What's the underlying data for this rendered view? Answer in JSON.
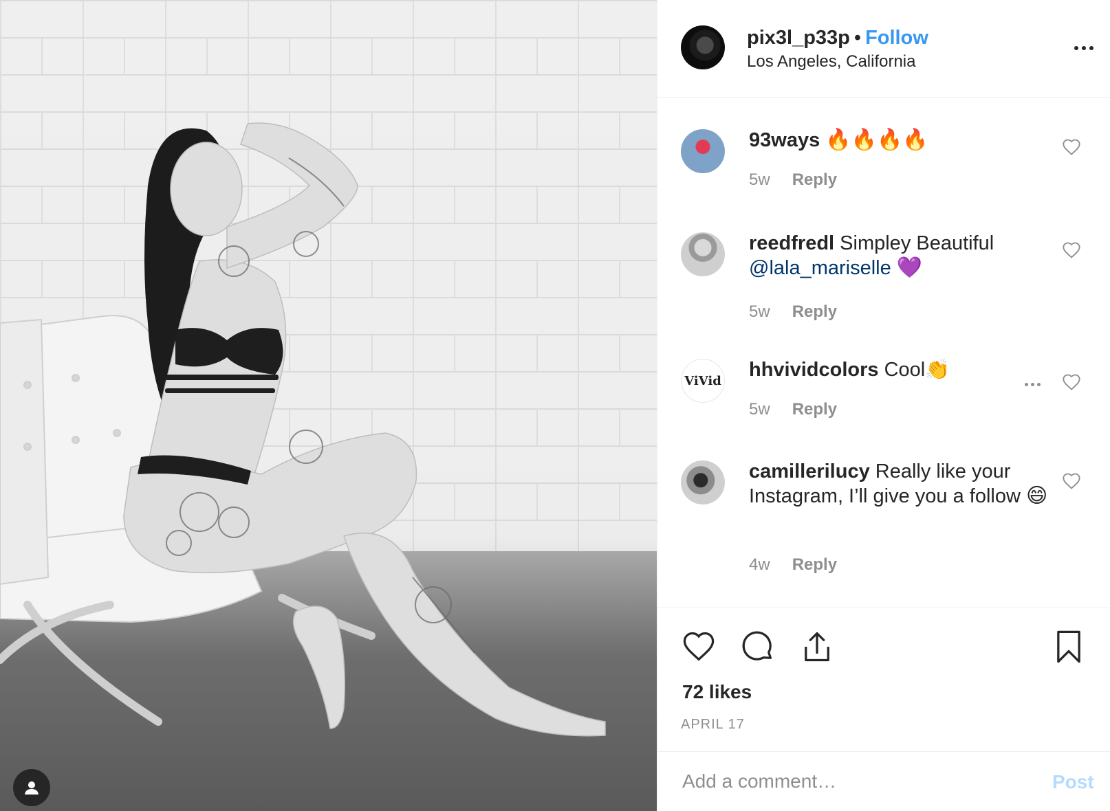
{
  "post": {
    "username": "pix3l_p33p",
    "separator": "•",
    "follow_label": "Follow",
    "location": "Los Angeles, California",
    "likes": "72 likes",
    "date": "APRIL 17"
  },
  "comments": [
    {
      "username": "93ways",
      "text": "🔥🔥🔥🔥",
      "mention": "",
      "trailing": "",
      "time": "5w",
      "reply_label": "Reply"
    },
    {
      "username": "reedfredl",
      "text": "Simpley Beautiful",
      "mention": "@lala_mariselle",
      "trailing": "💜",
      "time": "5w",
      "reply_label": "Reply"
    },
    {
      "username": "hhvividcolors",
      "text": "Cool👏",
      "mention": "",
      "trailing": "",
      "time": "5w",
      "reply_label": "Reply",
      "avatar_text": "ViVid"
    },
    {
      "username": "camillerilucy",
      "text": "Really like your Instagram, I’ll give you a follow",
      "mention": "",
      "trailing": "😄",
      "time": "4w",
      "reply_label": "Reply"
    }
  ],
  "add_comment": {
    "placeholder": "Add a comment…",
    "post_label": "Post"
  },
  "icons": {
    "more": "more-options-icon",
    "like": "heart-icon",
    "comment": "comment-bubble-icon",
    "share": "share-icon",
    "save": "bookmark-icon",
    "user": "user-icon"
  },
  "colors": {
    "follow": "#3897f0",
    "mention": "#00376b",
    "muted": "#8e8e8e",
    "post_disabled": "#b3dbff",
    "text": "#262626"
  }
}
